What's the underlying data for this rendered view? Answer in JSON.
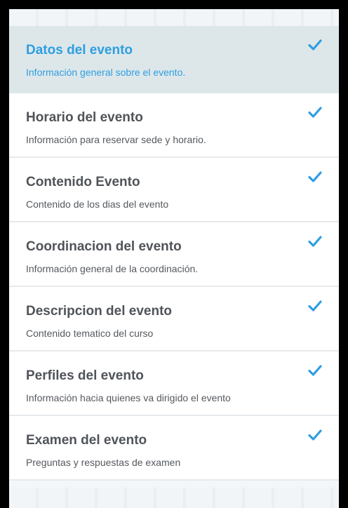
{
  "steps": [
    {
      "title": "Datos del evento",
      "description": "Información general sobre el evento.",
      "status": "completed",
      "active": true,
      "icon": "check-icon"
    },
    {
      "title": "Horario del evento",
      "description": "Información para reservar sede y horario.",
      "status": "completed",
      "active": false,
      "icon": "check-icon"
    },
    {
      "title": "Contenido Evento",
      "description": "Contenido de los dias del evento",
      "status": "completed",
      "active": false,
      "icon": "check-icon"
    },
    {
      "title": "Coordinacion del evento",
      "description": "Información general de la coordinación.",
      "status": "completed",
      "active": false,
      "icon": "check-icon"
    },
    {
      "title": "Descripcion del evento",
      "description": "Contenido tematico del curso",
      "status": "completed",
      "active": false,
      "icon": "check-icon"
    },
    {
      "title": "Perfiles del evento",
      "description": "Información hacia quienes va dirigido el evento",
      "status": "completed",
      "active": false,
      "icon": "check-icon"
    },
    {
      "title": "Examen del evento",
      "description": "Preguntas y respuestas de examen",
      "status": "completed",
      "active": false,
      "icon": "check-icon"
    }
  ],
  "colors": {
    "accent": "#2f9ee0",
    "active_background": "#dde7ea",
    "title_text": "#505459",
    "description_text": "#55595e",
    "check": "#2f9ee0"
  }
}
